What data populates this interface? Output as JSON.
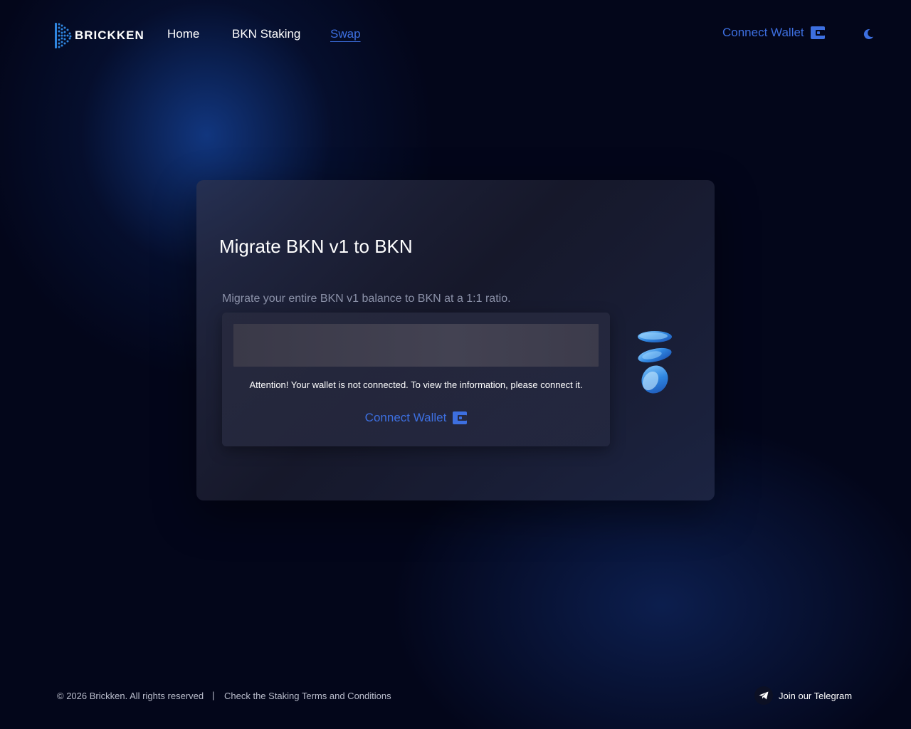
{
  "header": {
    "brand": "BRICKKEN",
    "nav": [
      {
        "label": "Home",
        "active": false
      },
      {
        "label": "BKN Staking",
        "active": false
      },
      {
        "label": "Swap",
        "active": true
      }
    ],
    "connect_wallet_label": "Connect Wallet",
    "wallet_icon": "wallet-icon",
    "theme_icon": "moon-icon"
  },
  "card": {
    "title": "Migrate BKN v1 to BKN",
    "subtitle": "Migrate your entire BKN v1 balance to BKN at a 1:1 ratio.",
    "attention": "Attention! Your wallet is not connected. To view the information, please connect it.",
    "connect_wallet_label": "Connect Wallet",
    "illustration": "coins-icon"
  },
  "footer": {
    "copyright": "© 2026 Brickken. All rights reserved",
    "divider": "|",
    "terms": "Check the Staking Terms and Conditions",
    "telegram_label": "Join our Telegram",
    "telegram_icon": "telegram-icon"
  },
  "colors": {
    "accent": "#3d6fe0",
    "background": "#03061a",
    "muted_text": "#8b91a8"
  }
}
